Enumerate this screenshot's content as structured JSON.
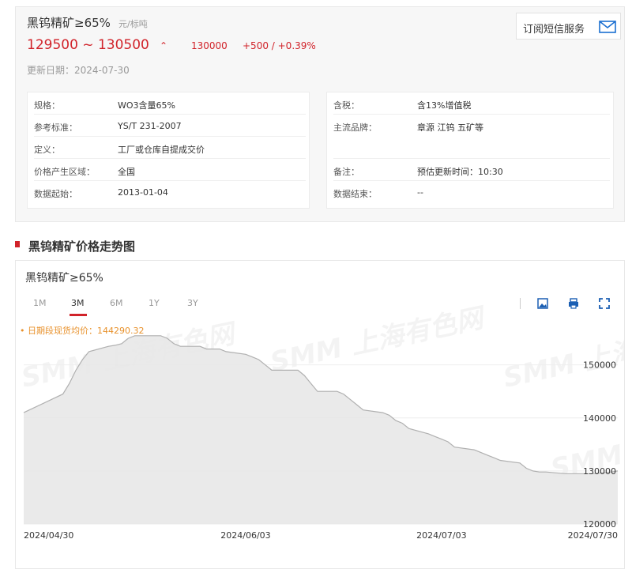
{
  "header": {
    "title": "黑钨精矿≥65%",
    "unit": "元/标吨",
    "price_range": "129500 ~ 130500",
    "avg_price": "130000",
    "change": "+500  /  +0.39%",
    "updated": "更新日期：2024-07-30",
    "subscribe_label": "订阅短信服务"
  },
  "spec_left": [
    {
      "label": "规格：",
      "value": "WO3含量65%"
    },
    {
      "label": "参考标准：",
      "value": "YS/T 231-2007"
    },
    {
      "label": "定义：",
      "value": "工厂或仓库自提成交价"
    },
    {
      "label": "价格产生区域：",
      "value": "全国"
    },
    {
      "label": "数据起始：",
      "value": "2013-01-04"
    }
  ],
  "spec_right": [
    {
      "label": "含税：",
      "value": "含13%增值税"
    },
    {
      "label": "主流品牌：",
      "value": "章源 江钨 五矿等"
    },
    {
      "label": "备注：",
      "value": "预估更新时间：10:30"
    },
    {
      "label": "数据结束：",
      "value": "--"
    }
  ],
  "section": {
    "title": "黑钨精矿价格走势图"
  },
  "chart_panel": {
    "title": "黑钨精矿≥65%",
    "tabs": [
      "1M",
      "3M",
      "6M",
      "1Y",
      "3Y"
    ],
    "active_tab": "3M",
    "avg_label": "• 日期段现货均价：144290.32",
    "watermark": "SMM 上海有色网"
  },
  "colors": {
    "accent": "#d1232a",
    "avg_label": "#e8912b",
    "line": "#b0b0b0"
  },
  "chart_data": {
    "type": "area",
    "x": [
      "2024-04-30",
      "2024-05-06",
      "2024-05-07",
      "2024-05-08",
      "2024-05-09",
      "2024-05-10",
      "2024-05-13",
      "2024-05-14",
      "2024-05-15",
      "2024-05-16",
      "2024-05-17",
      "2024-05-20",
      "2024-05-21",
      "2024-05-22",
      "2024-05-23",
      "2024-05-24",
      "2024-05-27",
      "2024-05-28",
      "2024-05-29",
      "2024-05-30",
      "2024-05-31",
      "2024-06-03",
      "2024-06-04",
      "2024-06-05",
      "2024-06-06",
      "2024-06-07",
      "2024-06-11",
      "2024-06-12",
      "2024-06-13",
      "2024-06-14",
      "2024-06-17",
      "2024-06-18",
      "2024-06-19",
      "2024-06-20",
      "2024-06-21",
      "2024-06-24",
      "2024-06-25",
      "2024-06-26",
      "2024-06-27",
      "2024-06-28",
      "2024-07-01",
      "2024-07-02",
      "2024-07-03",
      "2024-07-04",
      "2024-07-05",
      "2024-07-08",
      "2024-07-09",
      "2024-07-10",
      "2024-07-11",
      "2024-07-12",
      "2024-07-15",
      "2024-07-16",
      "2024-07-17",
      "2024-07-18",
      "2024-07-19",
      "2024-07-22",
      "2024-07-23",
      "2024-07-24",
      "2024-07-25",
      "2024-07-26",
      "2024-07-29",
      "2024-07-30"
    ],
    "values": [
      141000,
      144500,
      146500,
      149000,
      151000,
      152500,
      153500,
      153700,
      154000,
      155000,
      155500,
      155500,
      155500,
      155000,
      154000,
      153500,
      153500,
      153000,
      153000,
      153000,
      152500,
      152000,
      151500,
      151000,
      150000,
      149000,
      149000,
      148000,
      146500,
      145000,
      145000,
      144500,
      143500,
      142500,
      141500,
      141000,
      140500,
      139500,
      139000,
      138000,
      137000,
      136500,
      136000,
      135500,
      134500,
      134000,
      133500,
      133000,
      132500,
      132000,
      131500,
      130500,
      130000,
      129800,
      129800,
      129500,
      129500,
      129500,
      129500,
      129500,
      129800,
      130000
    ],
    "ylim": [
      120000,
      158000
    ],
    "yticks": [
      "120000",
      "130000",
      "140000",
      "150000"
    ],
    "xticks": [
      "2024/04/30",
      "2024/06/03",
      "2024/07/03",
      "2024/07/30"
    ],
    "grid": true
  }
}
